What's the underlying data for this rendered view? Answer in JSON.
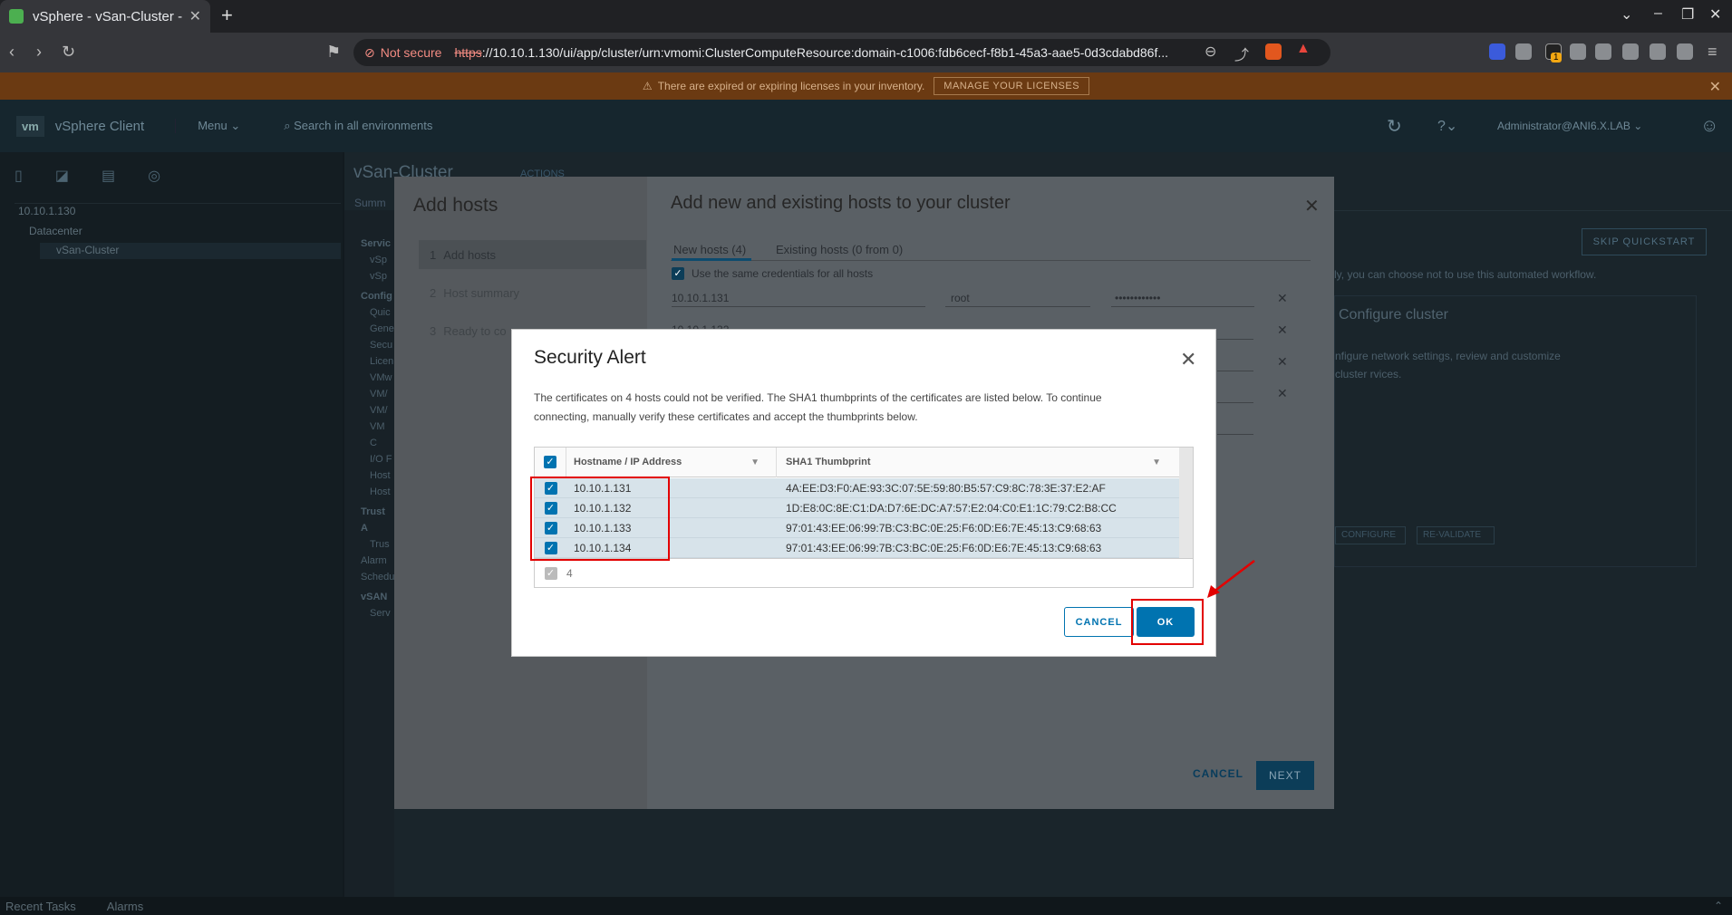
{
  "browser": {
    "tab_title": "vSphere - vSan-Cluster - ",
    "new_tab": "+",
    "url_warning": "Not secure",
    "url_scheme": "https",
    "url_rest": "://10.10.1.130/ui/app/cluster/urn:vmomi:ClusterComputeResource:domain-c1006:fdb6cecf-f8b1-45a3-aae5-0d3cdabd86f...",
    "extension_badge": "1"
  },
  "banner": {
    "message": "There are expired or expiring licenses in your inventory.",
    "button": "MANAGE YOUR LICENSES"
  },
  "vsphere": {
    "logo": "vm",
    "product": "vSphere Client",
    "menu": "Menu",
    "search_placeholder": "Search in all environments",
    "user": "Administrator@ANI6.X.LAB",
    "object_title": "vSan-Cluster",
    "actions": "ACTIONS",
    "summary_tab": "Summ",
    "tree": [
      "10.10.1.130",
      "Datacenter",
      "vSan-Cluster"
    ],
    "left_menu": [
      "Servic",
      "vSp",
      "vSp",
      "Config",
      "Quic",
      "Gene",
      "Secu",
      "Licen",
      "VMw",
      "VM/",
      "VM/",
      "VM C",
      "I/O F",
      "Host",
      "Host",
      "Trust A",
      "Trus",
      "Alarm",
      "Schedu",
      "vSAN",
      "Serv"
    ],
    "skip_quickstart": "SKIP QUICKSTART",
    "quickstart_text": "ly, you can choose not to use this automated workflow.",
    "configure_cluster_title": "Configure cluster",
    "configure_cluster_text": "nfigure network settings, review and customize cluster rvices.",
    "configure_btn": "CONFIGURE",
    "revalidate_btn": "RE-VALIDATE",
    "recent_tasks": "Recent Tasks",
    "alarms": "Alarms"
  },
  "wizard": {
    "title": "Add hosts",
    "steps": [
      {
        "num": "1",
        "label": "Add hosts"
      },
      {
        "num": "2",
        "label": "Host summary"
      },
      {
        "num": "3",
        "label": "Ready to co"
      }
    ],
    "heading": "Add new and existing hosts to your cluster",
    "tabs": [
      "New hosts (4)",
      "Existing hosts (0 from 0)"
    ],
    "same_credentials": "Use the same credentials for all hosts",
    "first_host": "10.10.1.131",
    "second_host": "10.10.1.132",
    "username": "root",
    "password": "••••••••••••",
    "cancel": "CANCEL",
    "next": "NEXT"
  },
  "security_alert": {
    "title": "Security Alert",
    "description": "The certificates on 4 hosts could not be verified. The SHA1 thumbprints of the certificates are listed below. To continue connecting, manually verify these certificates and accept the thumbprints below.",
    "columns": [
      "Hostname / IP Address",
      "SHA1 Thumbprint"
    ],
    "rows": [
      {
        "host": "10.10.1.131",
        "thumbprint": "4A:EE:D3:F0:AE:93:3C:07:5E:59:80:B5:57:C9:8C:78:3E:37:E2:AF"
      },
      {
        "host": "10.10.1.132",
        "thumbprint": "1D:E8:0C:8E:C1:DA:D7:6E:DC:A7:57:E2:04:C0:E1:1C:79:C2:B8:CC"
      },
      {
        "host": "10.10.1.133",
        "thumbprint": "97:01:43:EE:06:99:7B:C3:BC:0E:25:F6:0D:E6:7E:45:13:C9:68:63"
      },
      {
        "host": "10.10.1.134",
        "thumbprint": "97:01:43:EE:06:99:7B:C3:BC:0E:25:F6:0D:E6:7E:45:13:C9:68:63"
      }
    ],
    "selected_count": "4",
    "cancel": "CANCEL",
    "ok": "OK"
  },
  "colors": {
    "accent": "#0073b0",
    "annotation_red": "#e30000",
    "banner": "#6b3a12"
  }
}
